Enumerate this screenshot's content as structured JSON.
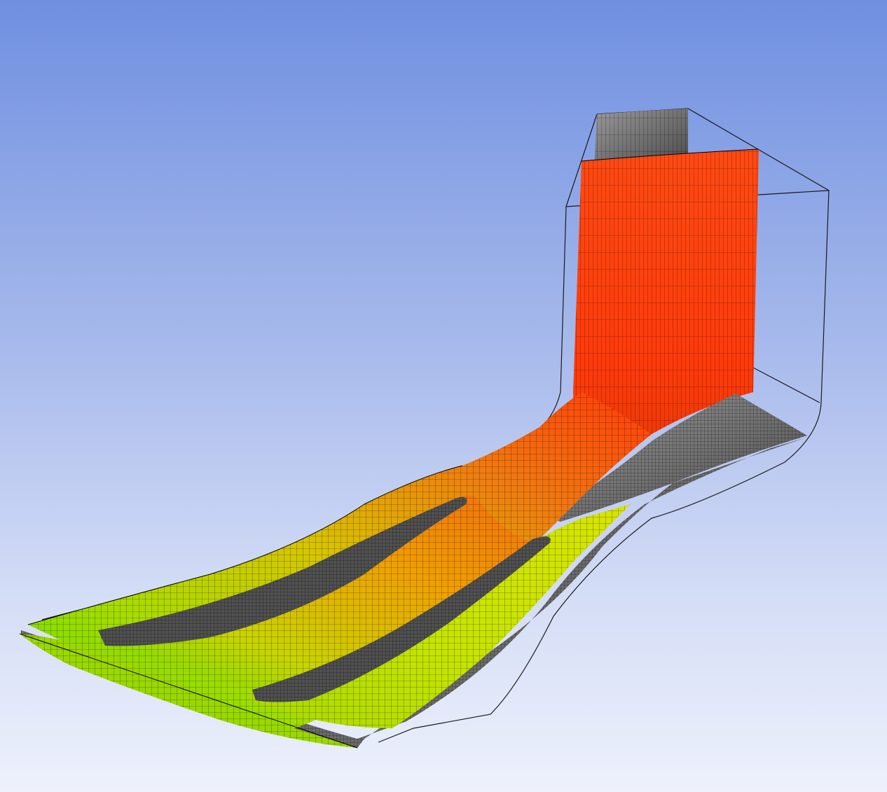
{
  "viewport": {
    "background_top": "#6f8fe0",
    "background_bottom": "#eef1fc"
  },
  "colors": {
    "hot": "#ff3a0a",
    "warm": "#f5a000",
    "mild": "#c8e000",
    "cool": "#5cdc00",
    "wall": "#8a8a8a",
    "mesh_line": "#000000",
    "outline": "#1a1a1a"
  },
  "scene": {
    "description_icon": "cfd-mesh-contour-3d"
  }
}
